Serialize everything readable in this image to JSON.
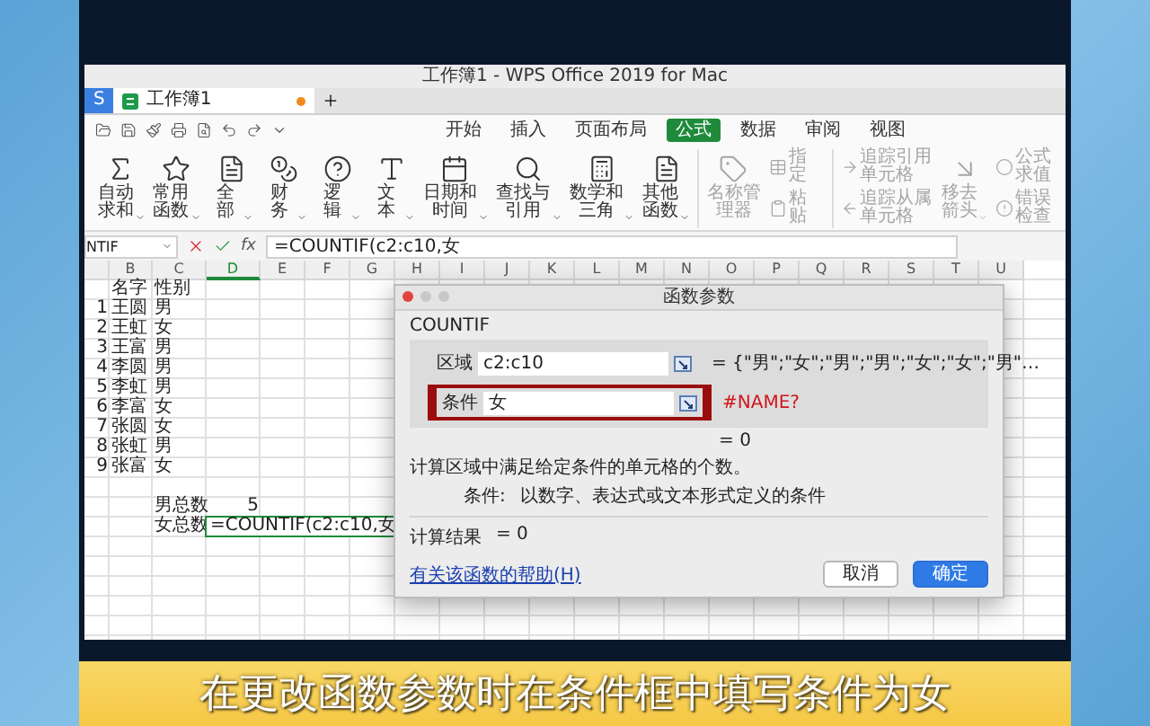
{
  "window": {
    "title": "工作簿1 - WPS Office 2019 for Mac"
  },
  "doc_tabs": [
    {
      "label": "S",
      "kind": "home",
      "selected": false,
      "modified": false
    },
    {
      "label": "工作簿1",
      "kind": "sheet",
      "selected": true,
      "modified": true
    }
  ],
  "menu_tabs": [
    {
      "label": "开始",
      "selected": false
    },
    {
      "label": "插入",
      "selected": false
    },
    {
      "label": "页面布局",
      "selected": false
    },
    {
      "label": "公式",
      "selected": true
    },
    {
      "label": "数据",
      "selected": false
    },
    {
      "label": "审阅",
      "selected": false
    },
    {
      "label": "视图",
      "selected": false
    }
  ],
  "ribbon": {
    "sections": [
      {
        "groups": [
          {
            "kind": "large",
            "label": "自动求和",
            "dropdown": true,
            "disabled": false
          },
          {
            "kind": "large",
            "label": "常用函数",
            "dropdown": true,
            "disabled": false
          },
          {
            "kind": "large",
            "label": "全部",
            "dropdown": true,
            "disabled": false
          },
          {
            "kind": "large",
            "label": "财务",
            "dropdown": true,
            "disabled": false
          },
          {
            "kind": "large",
            "label": "逻辑",
            "dropdown": true,
            "disabled": false
          },
          {
            "kind": "large",
            "label": "文本",
            "dropdown": true,
            "disabled": false
          },
          {
            "kind": "large",
            "label": "日期和时间",
            "dropdown": true,
            "disabled": false
          },
          {
            "kind": "large",
            "label": "查找与引用",
            "dropdown": true,
            "disabled": false
          },
          {
            "kind": "large",
            "label": "数学和三角",
            "dropdown": true,
            "disabled": false
          },
          {
            "kind": "large",
            "label": "其他函数",
            "dropdown": true,
            "disabled": false
          }
        ]
      },
      {
        "groups": [
          {
            "kind": "large",
            "label": "名称管理器",
            "dropdown": false,
            "disabled": true
          },
          {
            "kind": "stack",
            "items": [
              {
                "label": "指定",
                "disabled": true
              },
              {
                "label": "粘贴",
                "disabled": true
              }
            ]
          }
        ]
      },
      {
        "groups": [
          {
            "kind": "stack",
            "items": [
              {
                "label": "追踪引用单元格",
                "disabled": true
              },
              {
                "label": "追踪从属单元格",
                "disabled": true
              }
            ]
          },
          {
            "kind": "large",
            "label": "移去箭头",
            "dropdown": true,
            "disabled": true
          },
          {
            "kind": "stack",
            "items": [
              {
                "label": "公式求值",
                "disabled": true
              },
              {
                "label": "错误检查",
                "disabled": true
              }
            ]
          }
        ]
      }
    ]
  },
  "formula_bar": {
    "name_box": "NTIF",
    "fx_label": "fx",
    "formula": "=COUNTIF(c2:c10,女"
  },
  "sheet": {
    "columns": [
      {
        "label": "B",
        "selected": false
      },
      {
        "label": "C",
        "selected": false
      },
      {
        "label": "D",
        "selected": true
      },
      {
        "label": "E",
        "selected": false
      },
      {
        "label": "F",
        "selected": false
      },
      {
        "label": "G",
        "selected": false
      },
      {
        "label": "H",
        "selected": false
      },
      {
        "label": "I",
        "selected": false
      },
      {
        "label": "J",
        "selected": false
      },
      {
        "label": "K",
        "selected": false
      },
      {
        "label": "L",
        "selected": false
      },
      {
        "label": "M",
        "selected": false
      },
      {
        "label": "N",
        "selected": false
      },
      {
        "label": "O",
        "selected": false
      },
      {
        "label": "P",
        "selected": false
      },
      {
        "label": "Q",
        "selected": false
      },
      {
        "label": "R",
        "selected": false
      },
      {
        "label": "S",
        "selected": false
      },
      {
        "label": "T",
        "selected": false
      },
      {
        "label": "U",
        "selected": false
      }
    ],
    "rows": [
      {
        "cells": [
          null,
          {
            "text": "名字",
            "kind": "text",
            "selected": false
          },
          {
            "text": "性别",
            "kind": "text",
            "selected": false
          }
        ]
      },
      {
        "cells": [
          {
            "text": "1",
            "kind": "number",
            "selected": false
          },
          {
            "text": "王圆",
            "kind": "text",
            "selected": false
          },
          {
            "text": "男",
            "kind": "text",
            "selected": false
          }
        ]
      },
      {
        "cells": [
          {
            "text": "2",
            "kind": "number",
            "selected": false
          },
          {
            "text": "王虹",
            "kind": "text",
            "selected": false
          },
          {
            "text": "女",
            "kind": "text",
            "selected": false
          }
        ]
      },
      {
        "cells": [
          {
            "text": "3",
            "kind": "number",
            "selected": false
          },
          {
            "text": "王富",
            "kind": "text",
            "selected": false
          },
          {
            "text": "男",
            "kind": "text",
            "selected": false
          }
        ]
      },
      {
        "cells": [
          {
            "text": "4",
            "kind": "number",
            "selected": false
          },
          {
            "text": "李圆",
            "kind": "text",
            "selected": false
          },
          {
            "text": "男",
            "kind": "text",
            "selected": false
          }
        ]
      },
      {
        "cells": [
          {
            "text": "5",
            "kind": "number",
            "selected": false
          },
          {
            "text": "李虹",
            "kind": "text",
            "selected": false
          },
          {
            "text": "男",
            "kind": "text",
            "selected": false
          }
        ]
      },
      {
        "cells": [
          {
            "text": "6",
            "kind": "number",
            "selected": false
          },
          {
            "text": "李富",
            "kind": "text",
            "selected": false
          },
          {
            "text": "女",
            "kind": "text",
            "selected": false
          }
        ]
      },
      {
        "cells": [
          {
            "text": "7",
            "kind": "number",
            "selected": false
          },
          {
            "text": "张圆",
            "kind": "text",
            "selected": false
          },
          {
            "text": "女",
            "kind": "text",
            "selected": false
          }
        ]
      },
      {
        "cells": [
          {
            "text": "8",
            "kind": "number",
            "selected": false
          },
          {
            "text": "张虹",
            "kind": "text",
            "selected": false
          },
          {
            "text": "男",
            "kind": "text",
            "selected": false
          }
        ]
      },
      {
        "cells": [
          {
            "text": "9",
            "kind": "number",
            "selected": false
          },
          {
            "text": "张富",
            "kind": "text",
            "selected": false
          },
          {
            "text": "女",
            "kind": "text",
            "selected": false
          }
        ]
      },
      null,
      {
        "cells": [
          null,
          null,
          {
            "text": "男总数",
            "kind": "text",
            "selected": false
          },
          {
            "text": "5",
            "kind": "number",
            "selected": false
          }
        ]
      },
      {
        "cells": [
          null,
          null,
          {
            "text": "女总数",
            "kind": "text",
            "selected": false
          },
          {
            "text": "=COUNTIF(c2:c10,女",
            "kind": "text",
            "selected": true
          }
        ]
      }
    ]
  },
  "dialog": {
    "title": "函数参数",
    "function": "COUNTIF",
    "params": [
      {
        "label": "区域",
        "value": "c2:c10",
        "result": "= {\"男\";\"女\";\"男\";\"男\";\"女\";\"女\";\"男\"…",
        "focused": false,
        "error": false
      },
      {
        "label": "条件",
        "value": "女",
        "result": "#NAME?",
        "focused": true,
        "error": true
      }
    ],
    "function_result": "= 0",
    "description": "计算区域中满足给定条件的单元格的个数。",
    "param_help_label": "条件:",
    "param_help": "以数字、表达式或文本形式定义的条件",
    "result_label": "计算结果",
    "result_value": "= 0",
    "help_link": "有关该函数的帮助(H)",
    "buttons": [
      {
        "label": "取消",
        "kind": "secondary"
      },
      {
        "label": "确定",
        "kind": "primary"
      }
    ]
  },
  "subtitle": "在更改函数参数时在条件框中填写条件为女"
}
